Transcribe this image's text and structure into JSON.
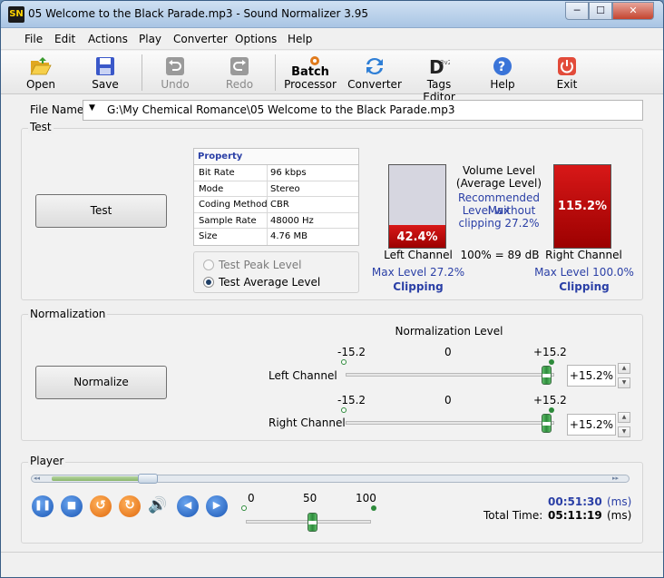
{
  "window": {
    "title": "05 Welcome to the Black Parade.mp3 - Sound Normalizer 3.95",
    "app_icon": "SN",
    "min": "─",
    "max": "☐",
    "close": "✕"
  },
  "menu": [
    "File",
    "Edit",
    "Actions",
    "Play",
    "Converter",
    "Options",
    "Help"
  ],
  "toolbar": {
    "open": "Open",
    "save": "Save",
    "undo": "Undo",
    "redo": "Redo",
    "batch_1": "Batch",
    "batch_2": "Processor",
    "converter": "Converter",
    "tags": "Tags Editor",
    "help": "Help",
    "exit": "Exit"
  },
  "file": {
    "label": "File Name:",
    "value": "G:\\My Chemical Romance\\05 Welcome to the Black Parade.mp3",
    "arrow": "▼"
  },
  "test": {
    "group": "Test",
    "button": "Test",
    "property_header": "Property",
    "properties": [
      {
        "key": "Bit Rate",
        "value": "96 kbps"
      },
      {
        "key": "Mode",
        "value": "Stereo"
      },
      {
        "key": "Coding Method",
        "value": "CBR"
      },
      {
        "key": "Sample Rate",
        "value": "48000 Hz"
      },
      {
        "key": "Size",
        "value": "4.76 MB"
      }
    ],
    "radio_peak": "Test Peak Level",
    "radio_average": "Test Average Level",
    "left_meter": "42.4%",
    "left_level": 42.4,
    "right_meter": "115.2%",
    "right_level": 100,
    "left_label": "Left Channel",
    "right_label": "Right Channel",
    "volume_1": "Volume Level",
    "volume_2": "(Average Level)",
    "rec_1": "Recommended Max",
    "rec_2": "Level without",
    "rec_3": "clipping 27.2%",
    "db": "100% = 89 dB",
    "left_max": "Max Level 27.2%",
    "right_max": "Max Level 100.0%",
    "left_clip": "Clipping",
    "right_clip": "Clipping"
  },
  "normalization": {
    "group": "Normalization",
    "button": "Normalize",
    "level_label": "Normalization Level",
    "left_label": "Left Channel",
    "right_label": "Right Channel",
    "min": "-15.2",
    "mid": "0",
    "max": "+15.2",
    "left_value": "+15.2%",
    "right_value": "+15.2%",
    "up": "▲",
    "down": "▼"
  },
  "player": {
    "group": "Player",
    "seek_left": "◂◂",
    "seek_right": "▸▸",
    "vol_0": "0",
    "vol_50": "50",
    "vol_100": "100",
    "elapsed": "00:51:30",
    "elapsed_unit": "(ms)",
    "total_label": "Total Time:",
    "total": "05:11:19",
    "total_unit": "(ms)",
    "pause": "❚❚",
    "stop": "■",
    "rewind": "↺",
    "forward": "↻",
    "speaker": "🔊",
    "prev": "◀",
    "next": "▶"
  },
  "colors": {
    "accent": "#2a3fa6",
    "meter_red": "#c00000",
    "slider_green": "#2d8a3b"
  }
}
